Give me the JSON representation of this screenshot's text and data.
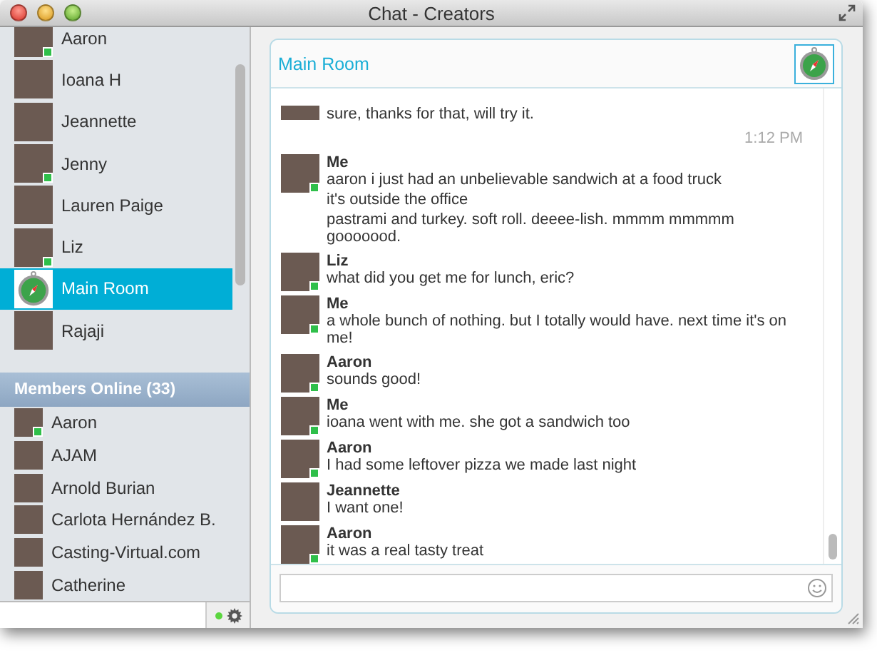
{
  "window": {
    "title": "Chat - Creators"
  },
  "contacts": [
    {
      "name": "Aaron",
      "kind": "person",
      "badge": true,
      "selected": false
    },
    {
      "name": "Ioana H",
      "kind": "person",
      "badge": false,
      "selected": false
    },
    {
      "name": "Jeannette",
      "kind": "person",
      "badge": false,
      "selected": false
    },
    {
      "name": "Jenny",
      "kind": "person",
      "badge": true,
      "selected": false
    },
    {
      "name": "Lauren Paige",
      "kind": "person",
      "badge": false,
      "selected": false
    },
    {
      "name": "Liz",
      "kind": "person",
      "badge": true,
      "selected": false
    },
    {
      "name": "Main Room",
      "kind": "room",
      "selected": true
    },
    {
      "name": "Rajaji",
      "kind": "person",
      "badge": false,
      "selected": false
    }
  ],
  "members_header": "Members Online (33)",
  "members": [
    {
      "name": "Aaron",
      "badge": true
    },
    {
      "name": "AJAM",
      "badge": false
    },
    {
      "name": "Arnold Burian",
      "badge": false
    },
    {
      "name": "Carlota Hernández B.",
      "badge": false
    },
    {
      "name": "Casting-Virtual.com",
      "badge": false
    },
    {
      "name": "Catherine",
      "badge": false
    }
  ],
  "status": {
    "online": true
  },
  "room": {
    "title": "Main Room"
  },
  "messages": [
    {
      "kind": "continuation",
      "lines": [
        "sure, thanks for that, will try it."
      ]
    },
    {
      "kind": "time",
      "text": "1:12 PM"
    },
    {
      "kind": "message",
      "sender": "Me",
      "badge": true,
      "lines": [
        "aaron i just had an unbelievable sandwich at a food truck",
        "it's outside the office",
        "pastrami and turkey. soft roll. deeee-lish. mmmm mmmmm gooooood."
      ]
    },
    {
      "kind": "message",
      "sender": "Liz",
      "badge": true,
      "lines": [
        "what did you get me for lunch, eric?"
      ]
    },
    {
      "kind": "message",
      "sender": "Me",
      "badge": true,
      "lines": [
        "a whole bunch of nothing. but I totally would have. next time it's on me!"
      ]
    },
    {
      "kind": "message",
      "sender": "Aaron",
      "badge": true,
      "lines": [
        "sounds good!"
      ]
    },
    {
      "kind": "message",
      "sender": "Me",
      "badge": true,
      "lines": [
        "ioana went with me. she got a sandwich too"
      ]
    },
    {
      "kind": "message",
      "sender": "Aaron",
      "badge": true,
      "lines": [
        "I had some leftover pizza we made last night"
      ]
    },
    {
      "kind": "message",
      "sender": "Jeannette",
      "badge": false,
      "lines": [
        "I want one!"
      ]
    },
    {
      "kind": "message",
      "sender": "Aaron",
      "badge": true,
      "lines": [
        "it was a real tasty treat"
      ]
    }
  ]
}
